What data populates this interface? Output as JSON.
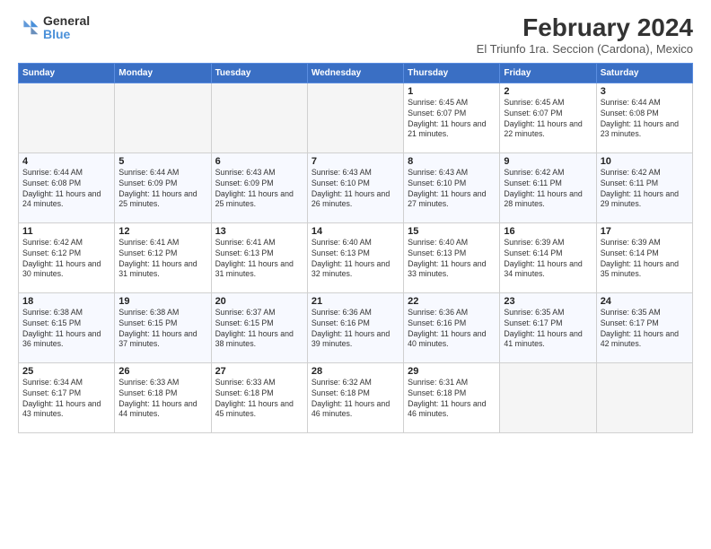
{
  "logo": {
    "line1": "General",
    "line2": "Blue"
  },
  "title": "February 2024",
  "subtitle": "El Triunfo 1ra. Seccion (Cardona), Mexico",
  "weekdays": [
    "Sunday",
    "Monday",
    "Tuesday",
    "Wednesday",
    "Thursday",
    "Friday",
    "Saturday"
  ],
  "weeks": [
    [
      {
        "day": "",
        "sunrise": "",
        "sunset": "",
        "daylight": ""
      },
      {
        "day": "",
        "sunrise": "",
        "sunset": "",
        "daylight": ""
      },
      {
        "day": "",
        "sunrise": "",
        "sunset": "",
        "daylight": ""
      },
      {
        "day": "",
        "sunrise": "",
        "sunset": "",
        "daylight": ""
      },
      {
        "day": "1",
        "sunrise": "Sunrise: 6:45 AM",
        "sunset": "Sunset: 6:07 PM",
        "daylight": "Daylight: 11 hours and 21 minutes."
      },
      {
        "day": "2",
        "sunrise": "Sunrise: 6:45 AM",
        "sunset": "Sunset: 6:07 PM",
        "daylight": "Daylight: 11 hours and 22 minutes."
      },
      {
        "day": "3",
        "sunrise": "Sunrise: 6:44 AM",
        "sunset": "Sunset: 6:08 PM",
        "daylight": "Daylight: 11 hours and 23 minutes."
      }
    ],
    [
      {
        "day": "4",
        "sunrise": "Sunrise: 6:44 AM",
        "sunset": "Sunset: 6:08 PM",
        "daylight": "Daylight: 11 hours and 24 minutes."
      },
      {
        "day": "5",
        "sunrise": "Sunrise: 6:44 AM",
        "sunset": "Sunset: 6:09 PM",
        "daylight": "Daylight: 11 hours and 25 minutes."
      },
      {
        "day": "6",
        "sunrise": "Sunrise: 6:43 AM",
        "sunset": "Sunset: 6:09 PM",
        "daylight": "Daylight: 11 hours and 25 minutes."
      },
      {
        "day": "7",
        "sunrise": "Sunrise: 6:43 AM",
        "sunset": "Sunset: 6:10 PM",
        "daylight": "Daylight: 11 hours and 26 minutes."
      },
      {
        "day": "8",
        "sunrise": "Sunrise: 6:43 AM",
        "sunset": "Sunset: 6:10 PM",
        "daylight": "Daylight: 11 hours and 27 minutes."
      },
      {
        "day": "9",
        "sunrise": "Sunrise: 6:42 AM",
        "sunset": "Sunset: 6:11 PM",
        "daylight": "Daylight: 11 hours and 28 minutes."
      },
      {
        "day": "10",
        "sunrise": "Sunrise: 6:42 AM",
        "sunset": "Sunset: 6:11 PM",
        "daylight": "Daylight: 11 hours and 29 minutes."
      }
    ],
    [
      {
        "day": "11",
        "sunrise": "Sunrise: 6:42 AM",
        "sunset": "Sunset: 6:12 PM",
        "daylight": "Daylight: 11 hours and 30 minutes."
      },
      {
        "day": "12",
        "sunrise": "Sunrise: 6:41 AM",
        "sunset": "Sunset: 6:12 PM",
        "daylight": "Daylight: 11 hours and 31 minutes."
      },
      {
        "day": "13",
        "sunrise": "Sunrise: 6:41 AM",
        "sunset": "Sunset: 6:13 PM",
        "daylight": "Daylight: 11 hours and 31 minutes."
      },
      {
        "day": "14",
        "sunrise": "Sunrise: 6:40 AM",
        "sunset": "Sunset: 6:13 PM",
        "daylight": "Daylight: 11 hours and 32 minutes."
      },
      {
        "day": "15",
        "sunrise": "Sunrise: 6:40 AM",
        "sunset": "Sunset: 6:13 PM",
        "daylight": "Daylight: 11 hours and 33 minutes."
      },
      {
        "day": "16",
        "sunrise": "Sunrise: 6:39 AM",
        "sunset": "Sunset: 6:14 PM",
        "daylight": "Daylight: 11 hours and 34 minutes."
      },
      {
        "day": "17",
        "sunrise": "Sunrise: 6:39 AM",
        "sunset": "Sunset: 6:14 PM",
        "daylight": "Daylight: 11 hours and 35 minutes."
      }
    ],
    [
      {
        "day": "18",
        "sunrise": "Sunrise: 6:38 AM",
        "sunset": "Sunset: 6:15 PM",
        "daylight": "Daylight: 11 hours and 36 minutes."
      },
      {
        "day": "19",
        "sunrise": "Sunrise: 6:38 AM",
        "sunset": "Sunset: 6:15 PM",
        "daylight": "Daylight: 11 hours and 37 minutes."
      },
      {
        "day": "20",
        "sunrise": "Sunrise: 6:37 AM",
        "sunset": "Sunset: 6:15 PM",
        "daylight": "Daylight: 11 hours and 38 minutes."
      },
      {
        "day": "21",
        "sunrise": "Sunrise: 6:36 AM",
        "sunset": "Sunset: 6:16 PM",
        "daylight": "Daylight: 11 hours and 39 minutes."
      },
      {
        "day": "22",
        "sunrise": "Sunrise: 6:36 AM",
        "sunset": "Sunset: 6:16 PM",
        "daylight": "Daylight: 11 hours and 40 minutes."
      },
      {
        "day": "23",
        "sunrise": "Sunrise: 6:35 AM",
        "sunset": "Sunset: 6:17 PM",
        "daylight": "Daylight: 11 hours and 41 minutes."
      },
      {
        "day": "24",
        "sunrise": "Sunrise: 6:35 AM",
        "sunset": "Sunset: 6:17 PM",
        "daylight": "Daylight: 11 hours and 42 minutes."
      }
    ],
    [
      {
        "day": "25",
        "sunrise": "Sunrise: 6:34 AM",
        "sunset": "Sunset: 6:17 PM",
        "daylight": "Daylight: 11 hours and 43 minutes."
      },
      {
        "day": "26",
        "sunrise": "Sunrise: 6:33 AM",
        "sunset": "Sunset: 6:18 PM",
        "daylight": "Daylight: 11 hours and 44 minutes."
      },
      {
        "day": "27",
        "sunrise": "Sunrise: 6:33 AM",
        "sunset": "Sunset: 6:18 PM",
        "daylight": "Daylight: 11 hours and 45 minutes."
      },
      {
        "day": "28",
        "sunrise": "Sunrise: 6:32 AM",
        "sunset": "Sunset: 6:18 PM",
        "daylight": "Daylight: 11 hours and 46 minutes."
      },
      {
        "day": "29",
        "sunrise": "Sunrise: 6:31 AM",
        "sunset": "Sunset: 6:18 PM",
        "daylight": "Daylight: 11 hours and 46 minutes."
      },
      {
        "day": "",
        "sunrise": "",
        "sunset": "",
        "daylight": ""
      },
      {
        "day": "",
        "sunrise": "",
        "sunset": "",
        "daylight": ""
      }
    ]
  ]
}
